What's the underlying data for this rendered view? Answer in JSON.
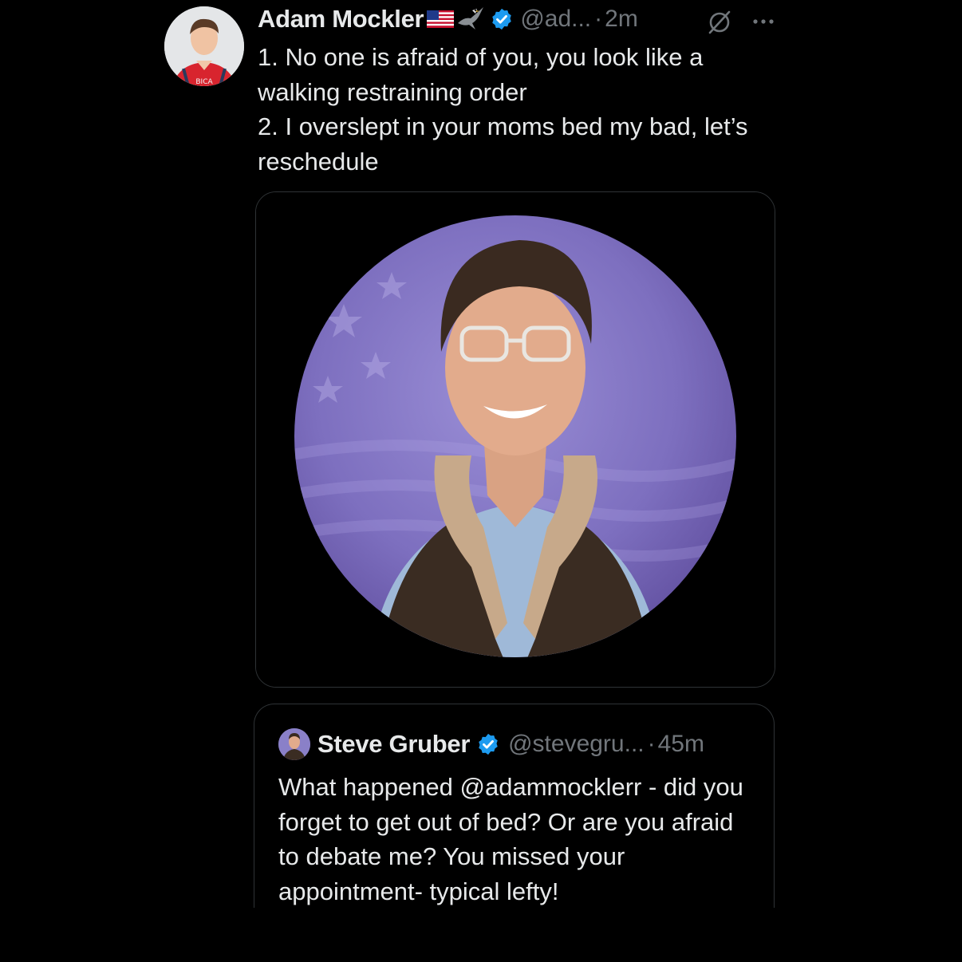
{
  "tweet": {
    "author": {
      "display_name": "Adam Mockler",
      "handle": "@ad...",
      "badges": [
        "us-flag-icon",
        "eagle-icon",
        "verified-badge-icon"
      ]
    },
    "separator": "·",
    "timestamp": "2m",
    "text_lines": [
      "1. No one is afraid of you, you look like a walking restraining order",
      "2. I overslept in your moms bed my bad, let’s reschedule"
    ],
    "media": {
      "kind": "image",
      "icon": "portrait-photo-icon"
    }
  },
  "quoted_tweet": {
    "author": {
      "display_name": "Steve Gruber",
      "handle": "@stevegru...",
      "badges": [
        "verified-badge-icon"
      ]
    },
    "separator": "·",
    "timestamp": "45m",
    "text": "What happened @adammocklerr - did you forget to get out of bed? Or are you afraid to debate me? You missed your appointment- typical lefty!"
  },
  "colors": {
    "background": "#000000",
    "primary_text": "#e7e9ea",
    "secondary_text": "#71767b",
    "border": "#2f3336",
    "verified": "#1d9bf0"
  }
}
